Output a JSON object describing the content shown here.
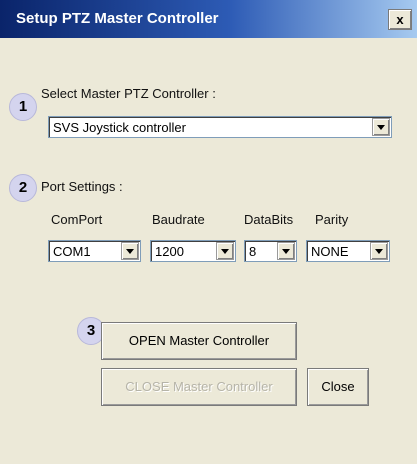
{
  "window": {
    "title": "Setup PTZ Master Controller",
    "close_glyph": "x"
  },
  "badges": [
    "1",
    "2",
    "3"
  ],
  "master": {
    "label": "Select Master PTZ Controller :",
    "selected": "SVS Joystick controller"
  },
  "port": {
    "label": "Port Settings :",
    "fields": {
      "comport": {
        "label": "ComPort",
        "value": "COM1"
      },
      "baudrate": {
        "label": "Baudrate",
        "value": "1200"
      },
      "databits": {
        "label": "DataBits",
        "value": "8"
      },
      "parity": {
        "label": "Parity",
        "value": "NONE"
      }
    }
  },
  "buttons": {
    "open": "OPEN Master Controller",
    "close_master": "CLOSE Master Controller",
    "close": "Close"
  },
  "icons": {
    "dropdown": "chevron-down-icon",
    "close": "close-icon"
  },
  "colors": {
    "title_start": "#0a246a",
    "title_end": "#a6caf0",
    "dialog_bg": "#ece9d8",
    "badge_bg": "#d4d4ee"
  }
}
